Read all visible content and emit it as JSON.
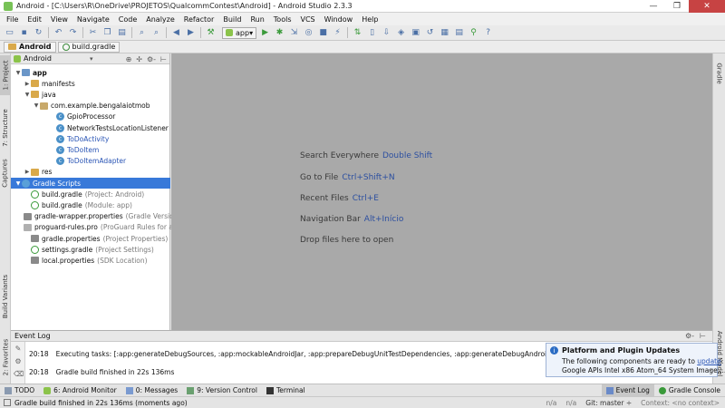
{
  "window": {
    "title": "Android - [C:\\Users\\R\\OneDrive\\PROJETOS\\QualcommContest\\Android] - Android Studio 2.3.3",
    "controls": [
      "—",
      "❐",
      "✕"
    ]
  },
  "menu": [
    "File",
    "Edit",
    "View",
    "Navigate",
    "Code",
    "Analyze",
    "Refactor",
    "Build",
    "Run",
    "Tools",
    "VCS",
    "Window",
    "Help"
  ],
  "toolbar": {
    "run_config": "app",
    "dropdown_glyph": "▾"
  },
  "breadcrumb": [
    "Android",
    "build.gradle"
  ],
  "left_tool_tabs": [
    "1: Project",
    "7: Structure",
    "Captures",
    "Build Variants",
    "2: Favorites"
  ],
  "right_tool_tabs": [
    "Gradle",
    "Android Model"
  ],
  "project_panel": {
    "view": "Android",
    "dropdown": "▾",
    "header_buttons": [
      "⊕",
      "✢",
      "⚙-",
      "⊢"
    ],
    "tree": [
      {
        "label": "app",
        "hint": "",
        "arrow": "▼",
        "icon": "folder-blue",
        "bold": true
      },
      {
        "label": "manifests",
        "hint": "",
        "arrow": "▶",
        "icon": "folder"
      },
      {
        "label": "java",
        "hint": "",
        "arrow": "▼",
        "icon": "folder"
      },
      {
        "label": "com.example.bengalaiotmob",
        "hint": "",
        "arrow": "▼",
        "icon": "pkg"
      },
      {
        "label": "GpioProcessor",
        "hint": "",
        "arrow": "",
        "icon": "cls"
      },
      {
        "label": "NetworkTestsLocationListener",
        "hint": "",
        "arrow": "",
        "icon": "cls"
      },
      {
        "label": "ToDoActivity",
        "hint": "",
        "arrow": "",
        "icon": "cls",
        "blue": true
      },
      {
        "label": "ToDoItem",
        "hint": "",
        "arrow": "",
        "icon": "cls",
        "blue": true
      },
      {
        "label": "ToDoItemAdapter",
        "hint": "",
        "arrow": "",
        "icon": "cls",
        "blue": true
      },
      {
        "label": "res",
        "hint": "",
        "arrow": "▶",
        "icon": "folder"
      },
      {
        "label": "Gradle Scripts",
        "hint": "",
        "arrow": "▼",
        "icon": "script",
        "selected": true
      },
      {
        "label": "build.gradle",
        "hint": "(Project: Android)",
        "arrow": "",
        "icon": "gradle"
      },
      {
        "label": "build.gradle",
        "hint": "(Module: app)",
        "arrow": "",
        "icon": "gradle"
      },
      {
        "label": "gradle-wrapper.properties",
        "hint": "(Gradle Version)",
        "arrow": "",
        "icon": "props"
      },
      {
        "label": "proguard-rules.pro",
        "hint": "(ProGuard Rules for app)",
        "arrow": "",
        "icon": "pro"
      },
      {
        "label": "gradle.properties",
        "hint": "(Project Properties)",
        "arrow": "",
        "icon": "props"
      },
      {
        "label": "settings.gradle",
        "hint": "(Project Settings)",
        "arrow": "",
        "icon": "gradle"
      },
      {
        "label": "local.properties",
        "hint": "(SDK Location)",
        "arrow": "",
        "icon": "props"
      }
    ]
  },
  "editor_hints": [
    {
      "text": "Search Everywhere",
      "shortcut": "Double Shift"
    },
    {
      "text": "Go to File",
      "shortcut": "Ctrl+Shift+N"
    },
    {
      "text": "Recent Files",
      "shortcut": "Ctrl+E"
    },
    {
      "text": "Navigation Bar",
      "shortcut": "Alt+Início"
    },
    {
      "text": "Drop files here to open",
      "shortcut": ""
    }
  ],
  "event_log": {
    "title": "Event Log",
    "header_buttons": [
      "⚙-",
      "⊢"
    ],
    "lines": [
      {
        "time": "20:18",
        "text": "Executing tasks: [:app:generateDebugSources, :app:mockableAndroidJar, :app:prepareDebugUnitTestDependencies, :app:generateDebugAndroidTestSources]"
      },
      {
        "time": "20:18",
        "text": "Gradle build finished in 22s 136ms"
      }
    ]
  },
  "notification": {
    "title": "Platform and Plugin Updates",
    "line1_prefix": "The following components are ready to ",
    "line1_link": "update",
    "line1_suffix": ":",
    "line2": "Google APIs Intel x86 Atom_64 System Image,...",
    "chevron": "⌄"
  },
  "bottom_tabs": [
    {
      "label": "TODO",
      "active": false
    },
    {
      "label": "6: Android Monitor",
      "active": false
    },
    {
      "label": "0: Messages",
      "active": false
    },
    {
      "label": "9: Version Control",
      "active": false
    },
    {
      "label": "Terminal",
      "active": false
    }
  ],
  "bottom_tabs_right": [
    {
      "label": "Event Log",
      "active": true
    },
    {
      "label": "Gradle Console",
      "active": false
    }
  ],
  "status": {
    "message": "Gradle build finished in 22s 136ms (moments ago)",
    "na1": "n/a",
    "na2": "n/a",
    "git": "Git: master ÷",
    "context": "Context: <no context>"
  },
  "colors": {
    "selection": "#3879d9",
    "editor_bg": "#a9a9a9",
    "link": "#2a55b5",
    "gradle_green": "#3a9a3a"
  }
}
